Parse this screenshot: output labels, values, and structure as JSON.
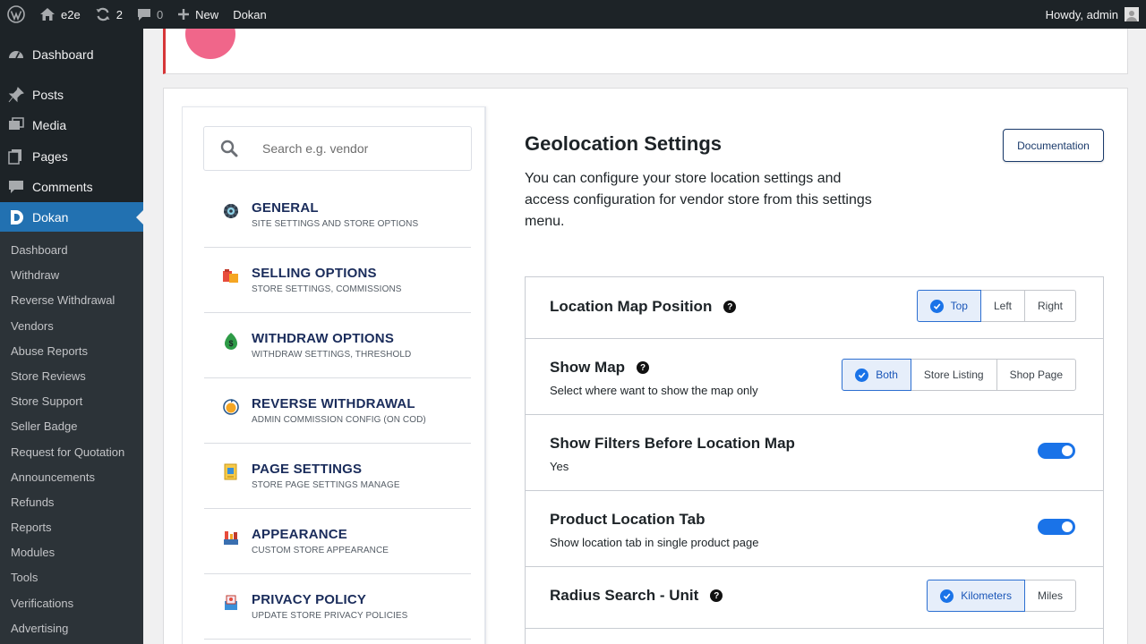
{
  "adminbar": {
    "site_name": "e2e",
    "updates_count": "2",
    "comments_count": "0",
    "new_label": "New",
    "dokan_label": "Dokan",
    "howdy": "Howdy, admin"
  },
  "sidebar": {
    "top": [
      {
        "label": "Dashboard",
        "icon": "dashboard-icon"
      },
      {
        "label": "Posts",
        "icon": "pin-icon"
      },
      {
        "label": "Media",
        "icon": "media-icon"
      },
      {
        "label": "Pages",
        "icon": "pages-icon"
      },
      {
        "label": "Comments",
        "icon": "comment-icon"
      },
      {
        "label": "Dokan",
        "icon": "dokan-icon"
      }
    ],
    "submenu": [
      "Dashboard",
      "Withdraw",
      "Reverse Withdrawal",
      "Vendors",
      "Abuse Reports",
      "Store Reviews",
      "Store Support",
      "Seller Badge",
      "Request for Quotation",
      "Announcements",
      "Refunds",
      "Reports",
      "Modules",
      "Tools",
      "Verifications",
      "Advertising"
    ]
  },
  "search": {
    "placeholder": "Search e.g. vendor"
  },
  "nav": [
    {
      "title": "GENERAL",
      "subtitle": "SITE SETTINGS AND STORE OPTIONS",
      "icon": "gear-icon"
    },
    {
      "title": "SELLING OPTIONS",
      "subtitle": "STORE SETTINGS, COMMISSIONS",
      "icon": "shopping-icon"
    },
    {
      "title": "WITHDRAW OPTIONS",
      "subtitle": "WITHDRAW SETTINGS, THRESHOLD",
      "icon": "money-icon"
    },
    {
      "title": "REVERSE WITHDRAWAL",
      "subtitle": "ADMIN COMMISSION CONFIG (ON COD)",
      "icon": "reverse-coin-icon"
    },
    {
      "title": "PAGE SETTINGS",
      "subtitle": "STORE PAGE SETTINGS MANAGE",
      "icon": "page-icon"
    },
    {
      "title": "APPEARANCE",
      "subtitle": "CUSTOM STORE APPEARANCE",
      "icon": "appearance-icon"
    },
    {
      "title": "PRIVACY POLICY",
      "subtitle": "UPDATE STORE PRIVACY POLICIES",
      "icon": "privacy-icon"
    }
  ],
  "settings": {
    "title": "Geolocation Settings",
    "description": "You can configure your store location settings and access configuration for vendor store from this settings menu.",
    "doc_button": "Documentation"
  },
  "fields": {
    "map_position": {
      "label": "Location Map Position",
      "options": [
        "Top",
        "Left",
        "Right"
      ],
      "selected": "Top"
    },
    "show_map": {
      "label": "Show Map",
      "description": "Select where want to show the map only",
      "options": [
        "Both",
        "Store Listing",
        "Shop Page"
      ],
      "selected": "Both"
    },
    "show_filters": {
      "label": "Show Filters Before Location Map",
      "description": "Yes",
      "enabled": true
    },
    "product_location_tab": {
      "label": "Product Location Tab",
      "description": "Show location tab in single product page",
      "enabled": true
    },
    "radius_unit": {
      "label": "Radius Search - Unit",
      "options": [
        "Kilometers",
        "Miles"
      ],
      "selected": "Kilometers"
    }
  },
  "colors": {
    "accent": "#2271b1",
    "toggle_on": "#1a73e8",
    "nav_title": "#1a2c5b"
  }
}
